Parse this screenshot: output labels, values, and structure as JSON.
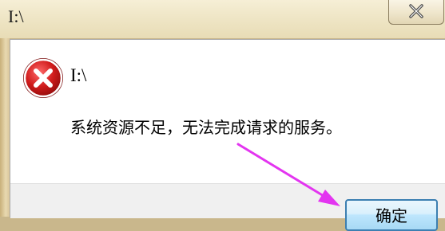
{
  "window": {
    "title": "I:\\",
    "close_icon": "close-icon"
  },
  "dialog": {
    "icon": "error-icon",
    "header": "I:\\",
    "message": "系统资源不足，无法完成请求的服务。",
    "ok_button_label": "确定"
  },
  "annotation": {
    "arrow_color": "#e335f0"
  },
  "colors": {
    "error_red": "#c8102e",
    "button_border": "#3c7fb1"
  }
}
